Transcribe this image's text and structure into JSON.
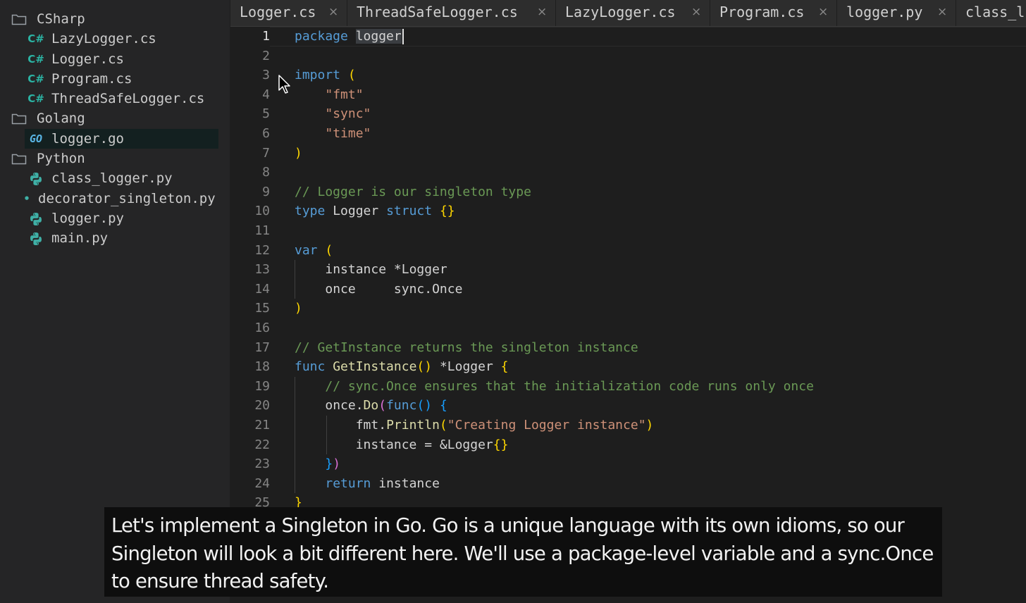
{
  "sidebar": {
    "folders": [
      {
        "label": "CSharp",
        "files": [
          {
            "label": "LazyLogger.cs",
            "icon": "csharp-icon",
            "icon_text": "C#"
          },
          {
            "label": "Logger.cs",
            "icon": "csharp-icon",
            "icon_text": "C#"
          },
          {
            "label": "Program.cs",
            "icon": "csharp-icon",
            "icon_text": "C#"
          },
          {
            "label": "ThreadSafeLogger.cs",
            "icon": "csharp-icon",
            "icon_text": "C#"
          }
        ]
      },
      {
        "label": "Golang",
        "files": [
          {
            "label": "logger.go",
            "icon": "go-icon",
            "icon_text": "GO",
            "selected": true
          }
        ]
      },
      {
        "label": "Python",
        "files": [
          {
            "label": "class_logger.py",
            "icon": "python-icon"
          },
          {
            "label": "decorator_singleton.py",
            "icon": "dot-icon"
          },
          {
            "label": "logger.py",
            "icon": "python-icon"
          },
          {
            "label": "main.py",
            "icon": "python-icon"
          }
        ]
      }
    ]
  },
  "tabs": [
    {
      "label": "Logger.cs"
    },
    {
      "label": "ThreadSafeLogger.cs"
    },
    {
      "label": "LazyLogger.cs"
    },
    {
      "label": "Program.cs"
    },
    {
      "label": "logger.py"
    },
    {
      "label": "class_l"
    }
  ],
  "tab_close_glyph": "×",
  "editor": {
    "active_line": 1,
    "lines": [
      {
        "n": "1",
        "tokens": [
          [
            "kw",
            "package"
          ],
          [
            "sp",
            " "
          ],
          [
            "sel",
            "logger"
          ]
        ],
        "cursor": true
      },
      {
        "n": "2",
        "tokens": []
      },
      {
        "n": "3",
        "tokens": [
          [
            "kw",
            "import"
          ],
          [
            "sp",
            " "
          ],
          [
            "br1",
            "("
          ]
        ]
      },
      {
        "n": "4",
        "tokens": [
          [
            "sp",
            "    "
          ],
          [
            "str",
            "\"fmt\""
          ]
        ]
      },
      {
        "n": "5",
        "tokens": [
          [
            "sp",
            "    "
          ],
          [
            "str",
            "\"sync\""
          ]
        ]
      },
      {
        "n": "6",
        "tokens": [
          [
            "sp",
            "    "
          ],
          [
            "str",
            "\"time\""
          ]
        ]
      },
      {
        "n": "7",
        "tokens": [
          [
            "br1",
            ")"
          ]
        ]
      },
      {
        "n": "8",
        "tokens": []
      },
      {
        "n": "9",
        "tokens": [
          [
            "com",
            "// Logger is our singleton type"
          ]
        ]
      },
      {
        "n": "10",
        "tokens": [
          [
            "kw",
            "type"
          ],
          [
            "sp",
            " "
          ],
          [
            "ty",
            "Logger"
          ],
          [
            "sp",
            " "
          ],
          [
            "kw",
            "struct"
          ],
          [
            "sp",
            " "
          ],
          [
            "br1",
            "{}"
          ]
        ]
      },
      {
        "n": "11",
        "tokens": []
      },
      {
        "n": "12",
        "tokens": [
          [
            "kw",
            "var"
          ],
          [
            "sp",
            " "
          ],
          [
            "br1",
            "("
          ]
        ]
      },
      {
        "n": "13",
        "tokens": [
          [
            "sp",
            "    "
          ],
          [
            "ty",
            "instance *Logger"
          ]
        ]
      },
      {
        "n": "14",
        "tokens": [
          [
            "sp",
            "    "
          ],
          [
            "ty",
            "once     sync.Once"
          ]
        ]
      },
      {
        "n": "15",
        "tokens": [
          [
            "br1",
            ")"
          ]
        ]
      },
      {
        "n": "16",
        "tokens": []
      },
      {
        "n": "17",
        "tokens": [
          [
            "com",
            "// GetInstance returns the singleton instance"
          ]
        ]
      },
      {
        "n": "18",
        "tokens": [
          [
            "kw",
            "func"
          ],
          [
            "sp",
            " "
          ],
          [
            "fn",
            "GetInstance"
          ],
          [
            "br1",
            "()"
          ],
          [
            "sp",
            " "
          ],
          [
            "ty",
            "*Logger"
          ],
          [
            "sp",
            " "
          ],
          [
            "br1",
            "{"
          ]
        ]
      },
      {
        "n": "19",
        "tokens": [
          [
            "sp",
            "    "
          ],
          [
            "com",
            "// sync.Once ensures that the initialization code runs only once"
          ]
        ]
      },
      {
        "n": "20",
        "tokens": [
          [
            "sp",
            "    "
          ],
          [
            "ty",
            "once."
          ],
          [
            "fn",
            "Do"
          ],
          [
            "br2",
            "("
          ],
          [
            "kw",
            "func"
          ],
          [
            "br3",
            "()"
          ],
          [
            "sp",
            " "
          ],
          [
            "br3",
            "{"
          ]
        ]
      },
      {
        "n": "21",
        "tokens": [
          [
            "sp",
            "        "
          ],
          [
            "ty",
            "fmt."
          ],
          [
            "fn",
            "Println"
          ],
          [
            "br1",
            "("
          ],
          [
            "str",
            "\"Creating Logger instance\""
          ],
          [
            "br1",
            ")"
          ]
        ]
      },
      {
        "n": "22",
        "tokens": [
          [
            "sp",
            "        "
          ],
          [
            "ty",
            "instance = &Logger"
          ],
          [
            "br1",
            "{}"
          ]
        ]
      },
      {
        "n": "23",
        "tokens": [
          [
            "sp",
            "    "
          ],
          [
            "br3",
            "}"
          ],
          [
            "br2",
            ")"
          ]
        ]
      },
      {
        "n": "24",
        "tokens": [
          [
            "sp",
            "    "
          ],
          [
            "kw",
            "return"
          ],
          [
            "sp",
            " "
          ],
          [
            "ty",
            "instance"
          ]
        ]
      },
      {
        "n": "25",
        "tokens": [
          [
            "br1",
            "}"
          ]
        ]
      }
    ]
  },
  "caption": {
    "text": "Let's implement a Singleton in Go. Go is a unique language with its own idioms, so our Singleton will look a bit different here. We'll use a package-level variable and a sync.Once to ensure thread safety."
  }
}
